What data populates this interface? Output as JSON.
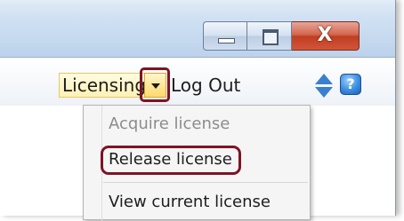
{
  "window": {
    "caption_buttons": {
      "minimize_icon": "minimize-icon",
      "maximize_icon": "maximize-icon",
      "close_icon": "close-icon",
      "close_glyph": "X"
    }
  },
  "toolbar": {
    "licensing_label": "Licensing",
    "logout_label": "Log Out",
    "help_glyph": "?"
  },
  "licensing_menu": {
    "items": [
      {
        "label": "Acquire license",
        "enabled": false
      },
      {
        "label": "Release license",
        "enabled": true,
        "highlighted": true
      },
      {
        "label": "View current license",
        "enabled": true
      }
    ]
  },
  "colors": {
    "highlight_outline": "#7d1424",
    "accent_blue": "#3a7fd0",
    "close_red": "#c03e22"
  }
}
